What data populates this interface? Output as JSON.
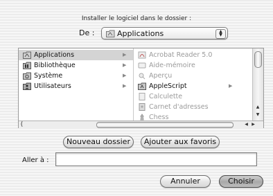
{
  "dialog": {
    "title": "Installer le logiciel dans le dossier :",
    "from_label": "De :",
    "location_value": "Applications"
  },
  "browser": {
    "column1": [
      {
        "label": "Applications",
        "icon": "applications-folder-icon",
        "selected": true
      },
      {
        "label": "Bibliothèque",
        "icon": "library-folder-icon",
        "selected": false
      },
      {
        "label": "Système",
        "icon": "system-folder-icon",
        "selected": false
      },
      {
        "label": "Utilisateurs",
        "icon": "users-folder-icon",
        "selected": false
      }
    ],
    "column2": [
      {
        "label": "Acrobat Reader 5.0",
        "icon": "app-icon",
        "disabled": true,
        "has_children": false
      },
      {
        "label": "Aide-mémoire",
        "icon": "app-icon",
        "disabled": true,
        "has_children": false
      },
      {
        "label": "Aperçu",
        "icon": "app-icon",
        "disabled": true,
        "has_children": false
      },
      {
        "label": "AppleScript",
        "icon": "folder-icon",
        "disabled": false,
        "has_children": true
      },
      {
        "label": "Calculette",
        "icon": "app-icon",
        "disabled": true,
        "has_children": false
      },
      {
        "label": "Carnet d'adresses",
        "icon": "app-icon",
        "disabled": true,
        "has_children": false
      },
      {
        "label": "Chess",
        "icon": "app-icon",
        "disabled": true,
        "has_children": false
      }
    ]
  },
  "buttons": {
    "new_folder": "Nouveau dossier",
    "add_favorites": "Ajouter aux favoris",
    "cancel": "Annuler",
    "choose": "Choisir"
  },
  "goto": {
    "label": "Aller à :",
    "value": ""
  }
}
